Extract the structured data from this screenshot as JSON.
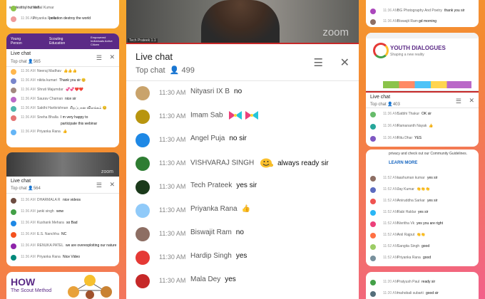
{
  "left_top": {
    "messages": [
      {
        "time": "11:36 AM",
        "name": "Vishal Kumar",
        "msg": "we destroy our self"
      },
      {
        "time": "11:36 AM",
        "name": "Priyanka Rana",
        "msg": "pollution destroy the world"
      }
    ]
  },
  "left_mid": {
    "banner": [
      "Young Person",
      "Scouting Education",
      "Empowered Individuals Active Citizen"
    ],
    "watermark": "zoom",
    "chat_title": "Live chat",
    "chat_mode": "Top chat",
    "viewers": "565",
    "messages": [
      {
        "time": "11:36 AM",
        "name": "Neeraj Madhav",
        "msg": "👍👍👍"
      },
      {
        "time": "11:36 AM",
        "name": "nikita kumari",
        "msg": "Thank you sir 😊"
      },
      {
        "time": "11:36 AM",
        "name": "Shruti Majumdar",
        "msg": "💞💞❤️❤️"
      },
      {
        "time": "11:36 AM",
        "name": "Saurav Chaman",
        "msg": "nice sir"
      },
      {
        "time": "11:36 AM",
        "name": "Sakthi Harikrishnan",
        "msg": "சிறப்பான விளக்கம் 😊"
      },
      {
        "time": "11:36 AM",
        "name": "Sneha Bhalla",
        "msg": "I m very happy to participate this webinar"
      },
      {
        "time": "11:36 AM",
        "name": "Priyanka Rana",
        "msg": "👍"
      }
    ]
  },
  "left_bot": {
    "chat_title": "Live chat",
    "chat_mode": "Top chat",
    "viewers": "564",
    "watermark": "zoom",
    "messages": [
      {
        "time": "11:36 AM",
        "name": "DHARMALA R",
        "msg": "nice videos"
      },
      {
        "time": "11:36 AM",
        "name": "janki singh",
        "msg": "wow"
      },
      {
        "time": "11:36 AM",
        "name": "Kushank Mehara",
        "msg": "so Bad"
      },
      {
        "time": "11:36 AM",
        "name": "E.S. Nanchha",
        "msg": "NC"
      },
      {
        "time": "11:36 AM",
        "name": "RENUKA PATEL",
        "msg": "we are overexploiting our nature"
      },
      {
        "time": "11:36 AM",
        "name": "Priyanka Rana",
        "msg": "Nice Video"
      }
    ]
  },
  "left_bottom_card": {
    "title": "HOW",
    "subtitle": "The Scout Method"
  },
  "center": {
    "video_label": "Tech Prateek 1.1",
    "watermark": "zoom",
    "chat_title": "Live chat",
    "chat_mode": "Top chat",
    "viewers": "499",
    "messages": [
      {
        "time": "11:30 AM",
        "name": "Nityasri IX B",
        "msg": "no",
        "color": "#c9a36b"
      },
      {
        "time": "11:30 AM",
        "name": "Imam Sab",
        "msg": "",
        "emoji": "bowtie",
        "color": "#b8950f"
      },
      {
        "time": "11:30 AM",
        "name": "Angel Puja",
        "msg": "no sir",
        "color": "#1e88e5"
      },
      {
        "time": "11:30 AM",
        "name": "VISHVARAJ SINGH",
        "msg": "always ready sir",
        "emoji": "smile",
        "color": "#2e7d32"
      },
      {
        "time": "11:30 AM",
        "name": "Tech Prateek",
        "msg": "yes sir",
        "color": "#1b3a1b"
      },
      {
        "time": "11:30 AM",
        "name": "Priyanka Rana",
        "msg": "👍",
        "color": "#90caf9"
      },
      {
        "time": "11:30 AM",
        "name": "Biswajit Ram",
        "msg": "no",
        "color": "#8d6e63"
      },
      {
        "time": "11:30 AM",
        "name": "Hardip Singh",
        "msg": "yes",
        "color": "#e53935"
      },
      {
        "time": "11:30 AM",
        "name": "Mala Dey",
        "msg": "yes",
        "color": "#c62828"
      }
    ]
  },
  "right_top": {
    "messages": [
      {
        "time": "11:36 AM",
        "name": "BG Photography And Poetry",
        "msg": "thank you sir"
      },
      {
        "time": "11:36 AM",
        "name": "Biswajit Ram",
        "msg": "gd morning"
      }
    ]
  },
  "right_mid": {
    "slide_title": "YOUTH DIALOGUES",
    "slide_sub": "Shaping a new reality",
    "chat_title": "Live chat",
    "chat_mode": "Top chat",
    "viewers": "403",
    "messages": [
      {
        "time": "11:36 AM",
        "name": "Satbhi Thakur",
        "msg": "OK sir"
      },
      {
        "time": "11:36 AM",
        "name": "Ramananth Nayak",
        "msg": "👍"
      },
      {
        "time": "11:36 AM",
        "name": "Ritu Dhar",
        "msg": "YES"
      }
    ]
  },
  "right_low": {
    "notice": "privacy and check out our Community Guidelines.",
    "learn_more": "LEARN MORE",
    "messages": [
      {
        "time": "11:52 AM",
        "name": "aashuman kumar",
        "msg": "yes sir"
      },
      {
        "time": "11:52 AM",
        "name": "Jay Kumar",
        "msg": "👏👏👏"
      },
      {
        "time": "11:52 AM",
        "name": "Aniruddha Sarkar",
        "msg": "yes sir"
      },
      {
        "time": "11:52 AM",
        "name": "Rabi Haldar",
        "msg": "yes sir"
      },
      {
        "time": "11:52 AM",
        "name": "Nivritha Vk",
        "msg": "yes you are right"
      },
      {
        "time": "11:52 AM",
        "name": "Anil Rajput",
        "msg": "👏👏"
      },
      {
        "time": "11:52 AM",
        "name": "Sangita Singh",
        "msg": "good"
      },
      {
        "time": "11:52 AM",
        "name": "Priyanka Rana",
        "msg": "good"
      }
    ]
  },
  "right_bot": {
    "messages": [
      {
        "time": "11:20 AM",
        "name": "Pratyush Paul",
        "msg": "ready sir"
      },
      {
        "time": "11:20 AM",
        "name": "mahobali subarti",
        "msg": "good sir"
      }
    ]
  },
  "colors": {
    "accent": "#c62828",
    "gray": "#666666",
    "purple": "#5b2a86"
  }
}
